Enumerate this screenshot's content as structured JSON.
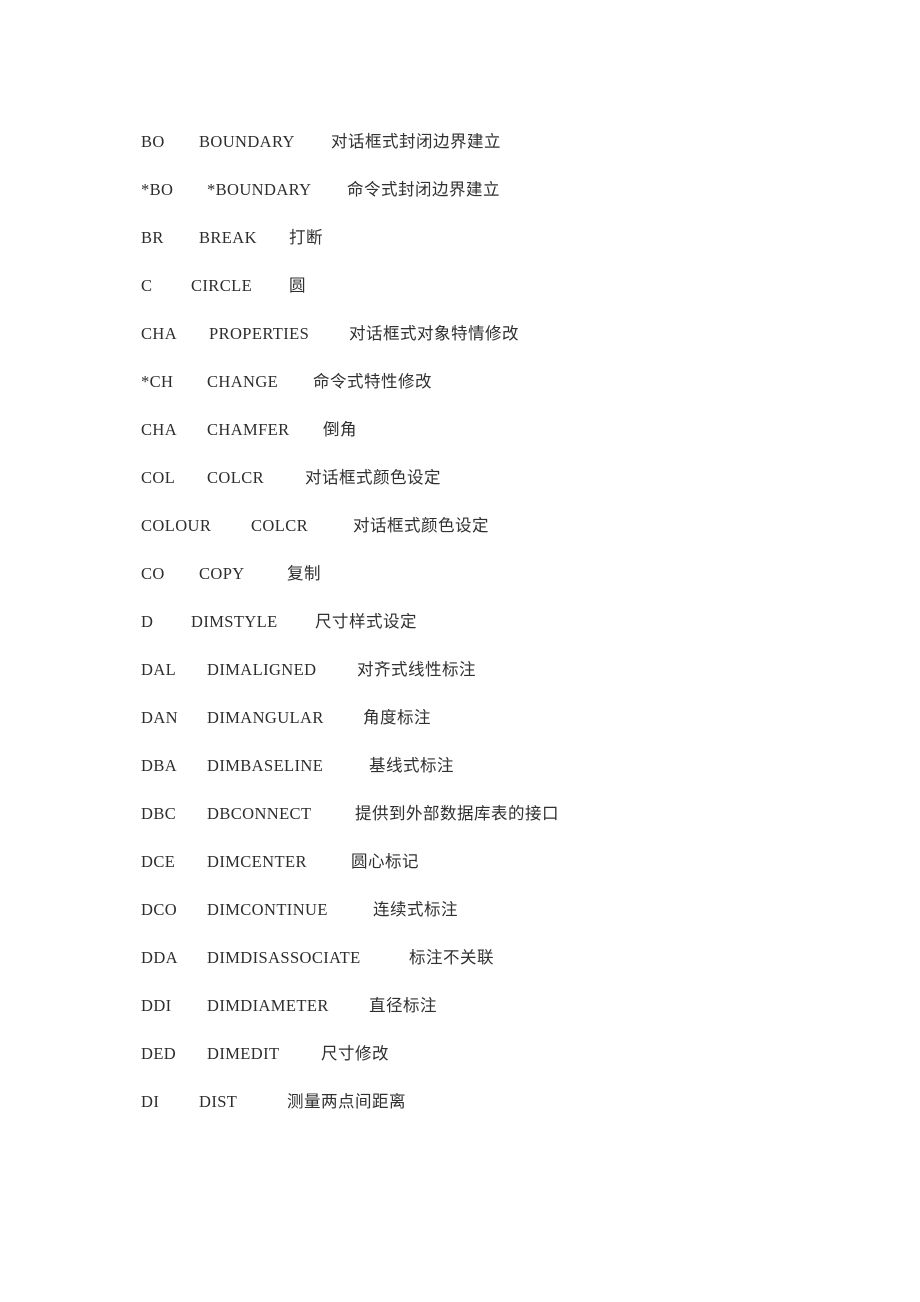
{
  "document": {
    "page_background": "#ffffff",
    "text_color": "#2d2d2d",
    "columns": [
      "alias",
      "command",
      "description"
    ],
    "rows": [
      {
        "alias": "BO",
        "command": "BOUNDARY",
        "desc": "对话框式封闭边界建立",
        "alias_w": 58,
        "cmd_w": 110,
        "cmd_gap": 0,
        "desc_gap": 22
      },
      {
        "alias": "*BO",
        "command": "*BOUNDARY",
        "desc": "命令式封闭边界建立",
        "alias_w": 58,
        "cmd_w": 110,
        "cmd_gap": 8,
        "desc_gap": 30
      },
      {
        "alias": "BR",
        "command": "BREAK",
        "desc": "打断",
        "alias_w": 58,
        "cmd_w": 68,
        "cmd_gap": 0,
        "desc_gap": 22
      },
      {
        "alias": "C",
        "command": "CIRCLE",
        "desc": "圆",
        "alias_w": 50,
        "cmd_w": 70,
        "cmd_gap": 0,
        "desc_gap": 28
      },
      {
        "alias": "CHA",
        "command": "PROPERTIES",
        "desc": "对话框式对象特情修改",
        "alias_w": 60,
        "cmd_w": 118,
        "cmd_gap": 8,
        "desc_gap": 22
      },
      {
        "alias": "*CH",
        "command": "CHANGE",
        "desc": "命令式特性修改",
        "alias_w": 58,
        "cmd_w": 80,
        "cmd_gap": 8,
        "desc_gap": 26
      },
      {
        "alias": "CHA",
        "command": "CHAMFER",
        "desc": "倒角",
        "alias_w": 58,
        "cmd_w": 90,
        "cmd_gap": 8,
        "desc_gap": 26
      },
      {
        "alias": "COL",
        "command": "COLCR",
        "desc": "对话框式颜色设定",
        "alias_w": 58,
        "cmd_w": 72,
        "cmd_gap": 8,
        "desc_gap": 26
      },
      {
        "alias": "COLOUR",
        "command": "COLCR",
        "desc": "对话框式颜色设定",
        "alias_w": 90,
        "cmd_w": 72,
        "cmd_gap": 20,
        "desc_gap": 30
      },
      {
        "alias": "CO",
        "command": "COPY",
        "desc": "复制",
        "alias_w": 58,
        "cmd_w": 62,
        "cmd_gap": 0,
        "desc_gap": 26
      },
      {
        "alias": "D",
        "command": "DIMSTYLE",
        "desc": "尺寸样式设定",
        "alias_w": 50,
        "cmd_w": 96,
        "cmd_gap": 0,
        "desc_gap": 28
      },
      {
        "alias": "DAL",
        "command": "DIMALIGNED",
        "desc": "对齐式线性标注",
        "alias_w": 58,
        "cmd_w": 128,
        "cmd_gap": 8,
        "desc_gap": 22
      },
      {
        "alias": "DAN",
        "command": "DIMANGULAR",
        "desc": "角度标注",
        "alias_w": 58,
        "cmd_w": 128,
        "cmd_gap": 8,
        "desc_gap": 28
      },
      {
        "alias": "DBA",
        "command": "DIMBASELINE",
        "desc": "基线式标注",
        "alias_w": 58,
        "cmd_w": 134,
        "cmd_gap": 8,
        "desc_gap": 28
      },
      {
        "alias": "DBC",
        "command": "DBCONNECT",
        "desc": "提供到外部数据库表的接口",
        "alias_w": 58,
        "cmd_w": 120,
        "cmd_gap": 8,
        "desc_gap": 28
      },
      {
        "alias": "DCE",
        "command": "DIMCENTER",
        "desc": "圆心标记",
        "alias_w": 58,
        "cmd_w": 118,
        "cmd_gap": 8,
        "desc_gap": 26
      },
      {
        "alias": "DCO",
        "command": "DIMCONTINUE",
        "desc": "连续式标注",
        "alias_w": 58,
        "cmd_w": 140,
        "cmd_gap": 8,
        "desc_gap": 26
      },
      {
        "alias": "DDA",
        "command": "DIMDISASSOCIATE",
        "desc": "标注不关联",
        "alias_w": 58,
        "cmd_w": 172,
        "cmd_gap": 8,
        "desc_gap": 30
      },
      {
        "alias": "DDI",
        "command": "DIMDIAMETER",
        "desc": "直径标注",
        "alias_w": 58,
        "cmd_w": 134,
        "cmd_gap": 8,
        "desc_gap": 28
      },
      {
        "alias": "DED",
        "command": "DIMEDIT",
        "desc": "尺寸修改",
        "alias_w": 58,
        "cmd_w": 88,
        "cmd_gap": 8,
        "desc_gap": 26
      },
      {
        "alias": "DI",
        "command": "DIST",
        "desc": "测量两点间距离",
        "alias_w": 58,
        "cmd_w": 62,
        "cmd_gap": 0,
        "desc_gap": 26
      }
    ]
  }
}
